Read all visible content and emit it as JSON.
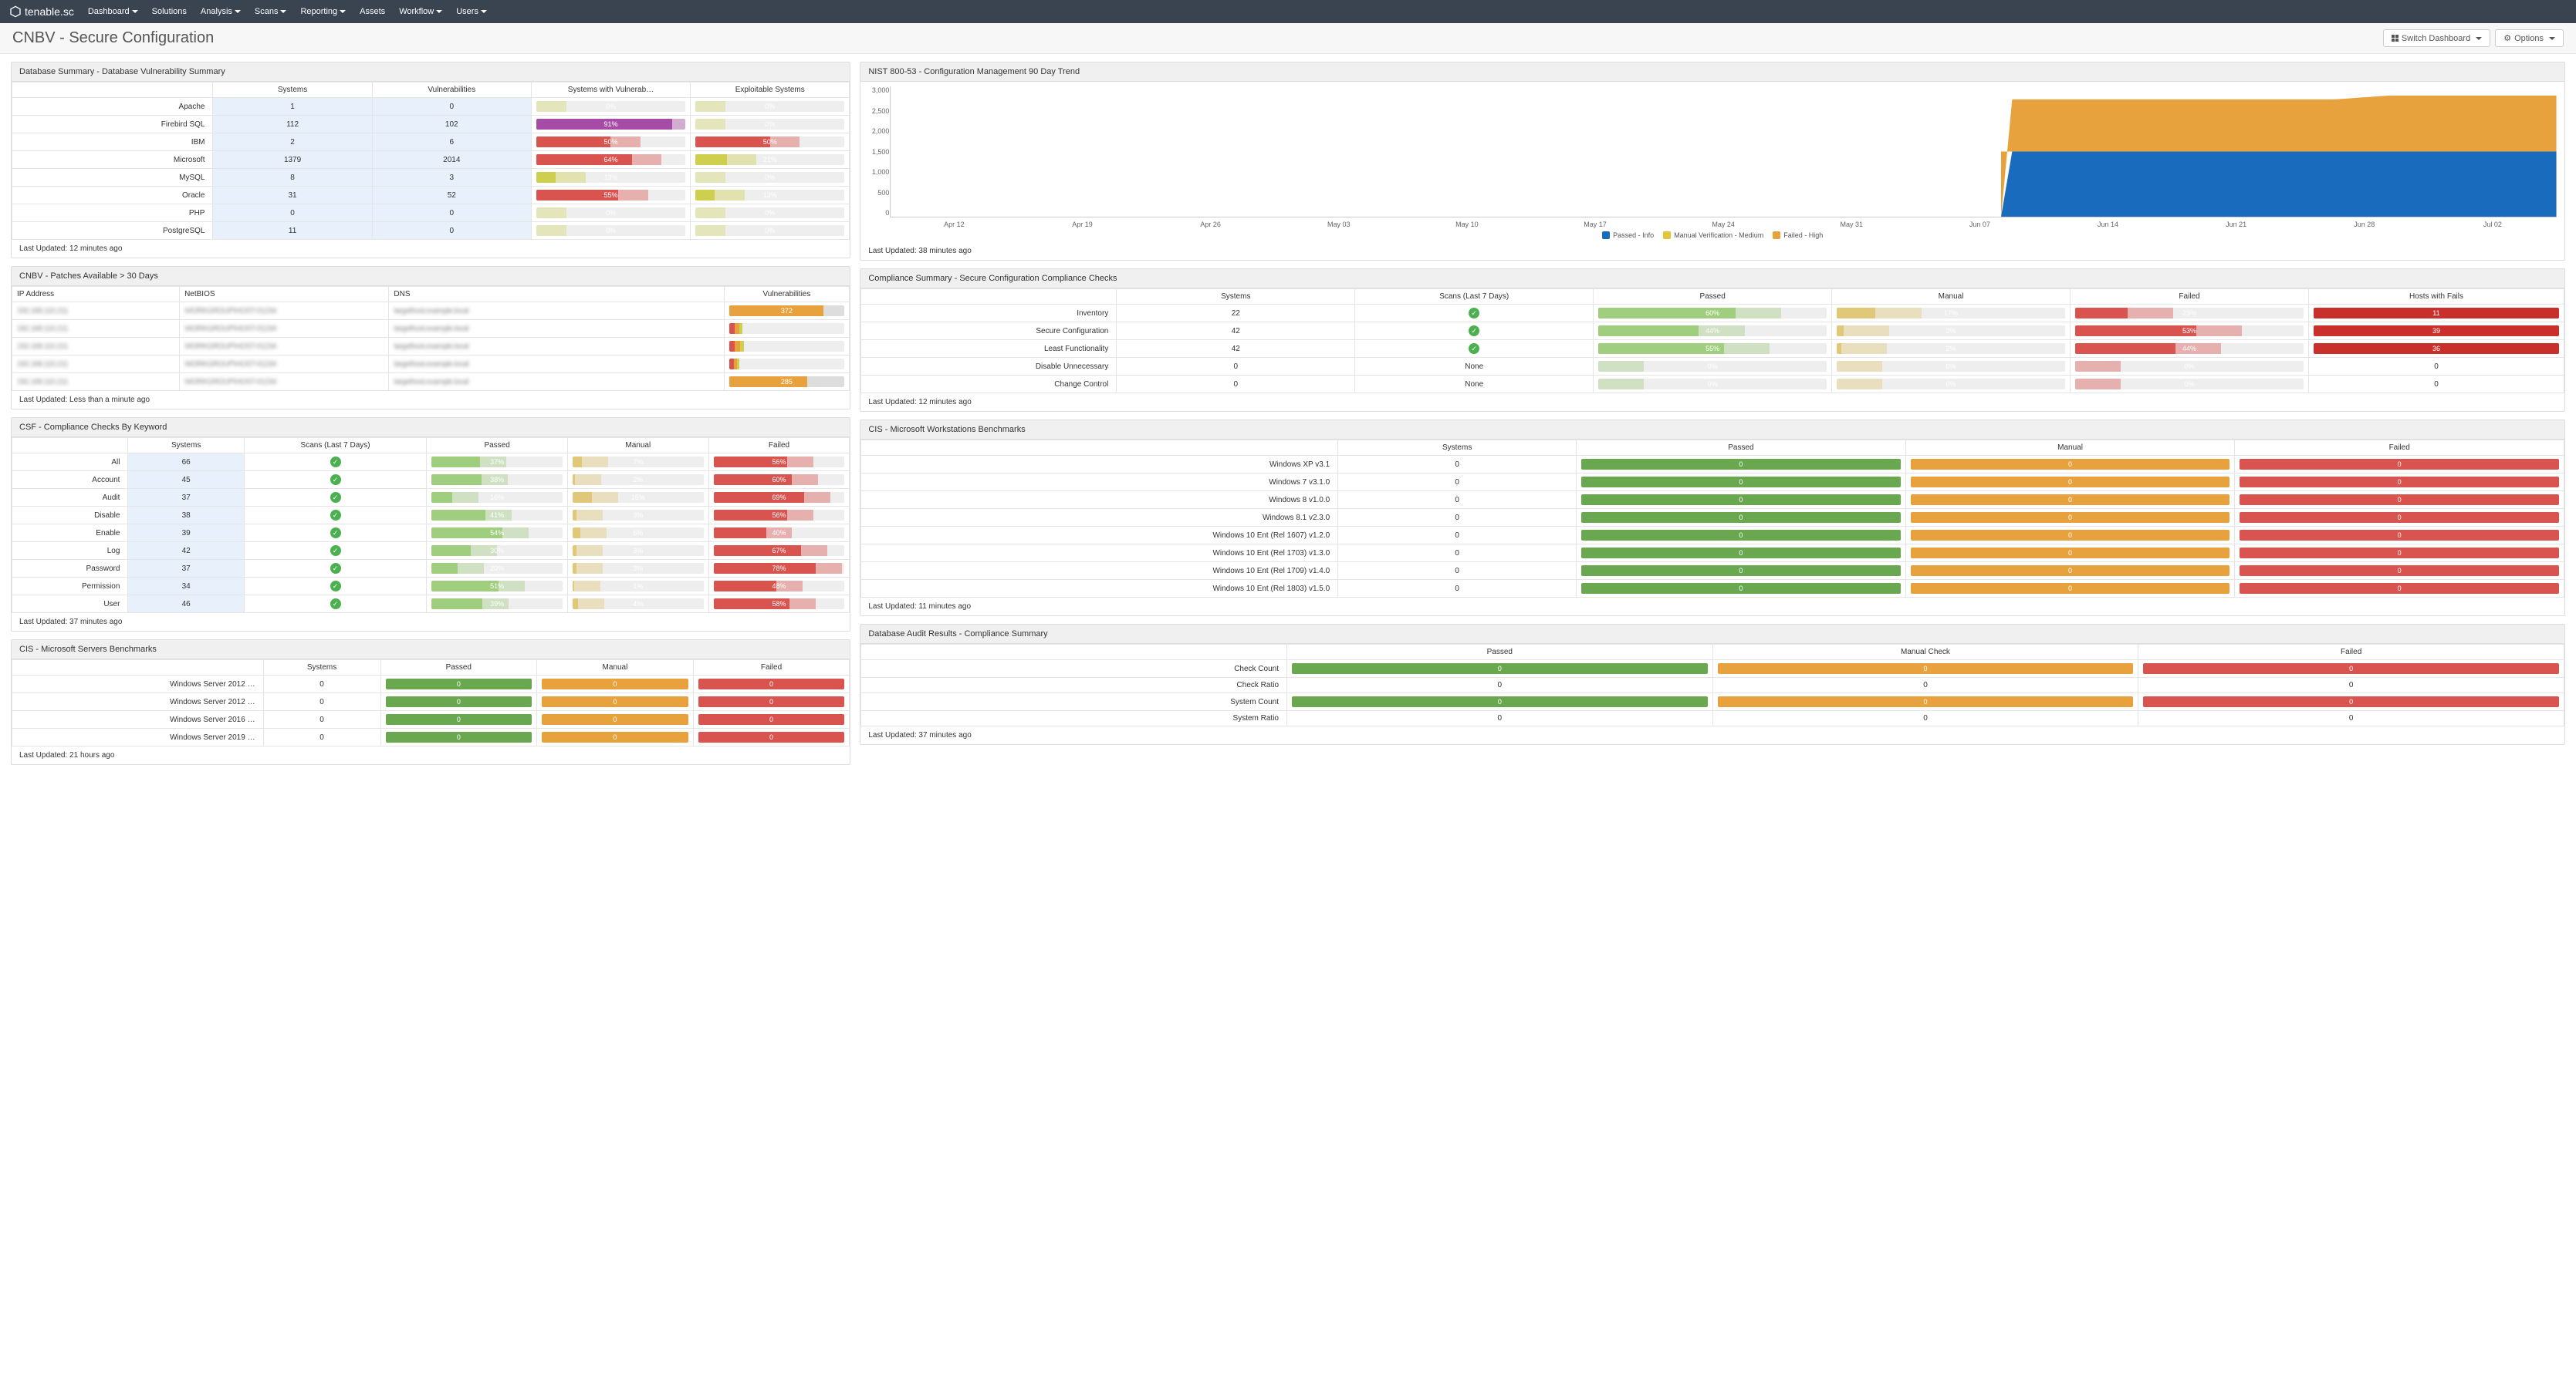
{
  "brand": "tenable.sc",
  "nav": [
    "Dashboard",
    "Solutions",
    "Analysis",
    "Scans",
    "Reporting",
    "Assets",
    "Workflow",
    "Users"
  ],
  "nav_has_caret": [
    true,
    false,
    true,
    true,
    true,
    false,
    true,
    true
  ],
  "page_title": "CNBV - Secure Configuration",
  "buttons": {
    "switch": "Switch Dashboard",
    "options": "Options"
  },
  "colors": {
    "green": "#6aa84f",
    "lightgreen": "#9fce7f",
    "yellow": "#d8d86f",
    "dyellow": "#cfcf4f",
    "orange": "#e8a23d",
    "red": "#d9534f",
    "darkred": "#c9302c",
    "pink": "#de7e7b",
    "purple": "#a64ca6",
    "blue": "#196bbd",
    "grey": "#ddd"
  },
  "panels": {
    "db_summary": {
      "title": "Database Summary - Database Vulnerability Summary",
      "headers": [
        "",
        "Systems",
        "Vulnerabilities",
        "Systems with Vulnerab…",
        "Exploitable Systems"
      ],
      "rows": [
        {
          "label": "Apache",
          "systems": "1",
          "vulns": "0",
          "swv": {
            "pct": 0,
            "txt": "0%",
            "color": "#d8d86f"
          },
          "exp": {
            "pct": 0,
            "txt": "0%",
            "color": "#d8d86f"
          }
        },
        {
          "label": "Firebird SQL",
          "systems": "112",
          "vulns": "102",
          "swv": {
            "pct": 91,
            "txt": "91%",
            "color": "#a64ca6"
          },
          "exp": {
            "pct": 0,
            "txt": "0%",
            "color": "#d8d86f"
          }
        },
        {
          "label": "IBM",
          "systems": "2",
          "vulns": "6",
          "swv": {
            "pct": 50,
            "txt": "50%",
            "color": "#d9534f"
          },
          "exp": {
            "pct": 50,
            "txt": "50%",
            "color": "#d9534f"
          }
        },
        {
          "label": "Microsoft",
          "systems": "1379",
          "vulns": "2014",
          "swv": {
            "pct": 64,
            "txt": "64%",
            "color": "#d9534f"
          },
          "exp": {
            "pct": 21,
            "txt": "21%",
            "color": "#cfcf4f"
          }
        },
        {
          "label": "MySQL",
          "systems": "8",
          "vulns": "3",
          "swv": {
            "pct": 13,
            "txt": "13%",
            "color": "#cfcf4f"
          },
          "exp": {
            "pct": 0,
            "txt": "0%",
            "color": "#d8d86f"
          }
        },
        {
          "label": "Oracle",
          "systems": "31",
          "vulns": "52",
          "swv": {
            "pct": 55,
            "txt": "55%",
            "color": "#d9534f"
          },
          "exp": {
            "pct": 13,
            "txt": "13%",
            "color": "#cfcf4f"
          }
        },
        {
          "label": "PHP",
          "systems": "0",
          "vulns": "0",
          "swv": {
            "pct": 0,
            "txt": "0%",
            "color": "#d8d86f"
          },
          "exp": {
            "pct": 0,
            "txt": "0%",
            "color": "#d8d86f"
          }
        },
        {
          "label": "PostgreSQL",
          "systems": "11",
          "vulns": "0",
          "swv": {
            "pct": 0,
            "txt": "0%",
            "color": "#d8d86f"
          },
          "exp": {
            "pct": 0,
            "txt": "0%",
            "color": "#d8d86f"
          }
        }
      ],
      "updated": "Last Updated: 12 minutes ago"
    },
    "patches": {
      "title": "CNBV - Patches Available > 30 Days",
      "headers": [
        "IP Address",
        "NetBIOS",
        "DNS",
        "Vulnerabilities"
      ],
      "rows": [
        {
          "vuln": "372",
          "segs": [
            {
              "w": 78,
              "c": "#e8a23d"
            },
            {
              "w": 4,
              "c": "#cfcf4f"
            }
          ]
        },
        {
          "vuln": "",
          "segs": [
            {
              "w": 5,
              "c": "#d9534f"
            },
            {
              "w": 4,
              "c": "#e8a23d"
            },
            {
              "w": 3,
              "c": "#cfcf4f"
            }
          ]
        },
        {
          "vuln": "",
          "segs": [
            {
              "w": 5,
              "c": "#d9534f"
            },
            {
              "w": 5,
              "c": "#e8a23d"
            },
            {
              "w": 3,
              "c": "#cfcf4f"
            }
          ]
        },
        {
          "vuln": "",
          "segs": [
            {
              "w": 4,
              "c": "#d9534f"
            },
            {
              "w": 3,
              "c": "#e8a23d"
            },
            {
              "w": 2,
              "c": "#cfcf4f"
            }
          ]
        },
        {
          "vuln": "285",
          "segs": [
            {
              "w": 60,
              "c": "#e8a23d"
            },
            {
              "w": 8,
              "c": "#cfcf4f"
            }
          ]
        }
      ],
      "updated": "Last Updated: Less than a minute ago"
    },
    "csf": {
      "title": "CSF - Compliance Checks By Keyword",
      "headers": [
        "",
        "Systems",
        "Scans (Last 7 Days)",
        "Passed",
        "Manual",
        "Failed"
      ],
      "rows": [
        {
          "label": "All",
          "systems": "66",
          "passed": {
            "pct": 37,
            "txt": "37%"
          },
          "manual": {
            "pct": 7,
            "txt": "7%"
          },
          "failed": {
            "pct": 56,
            "txt": "56%"
          }
        },
        {
          "label": "Account",
          "systems": "45",
          "passed": {
            "pct": 38,
            "txt": "38%"
          },
          "manual": {
            "pct": 2,
            "txt": "2%"
          },
          "failed": {
            "pct": 60,
            "txt": "60%"
          }
        },
        {
          "label": "Audit",
          "systems": "37",
          "passed": {
            "pct": 16,
            "txt": "16%"
          },
          "manual": {
            "pct": 15,
            "txt": "15%"
          },
          "failed": {
            "pct": 69,
            "txt": "69%"
          }
        },
        {
          "label": "Disable",
          "systems": "38",
          "passed": {
            "pct": 41,
            "txt": "41%"
          },
          "manual": {
            "pct": 3,
            "txt": "3%"
          },
          "failed": {
            "pct": 56,
            "txt": "56%"
          }
        },
        {
          "label": "Enable",
          "systems": "39",
          "passed": {
            "pct": 54,
            "txt": "54%"
          },
          "manual": {
            "pct": 6,
            "txt": "6%"
          },
          "failed": {
            "pct": 40,
            "txt": "40%"
          }
        },
        {
          "label": "Log",
          "systems": "42",
          "passed": {
            "pct": 30,
            "txt": "30%"
          },
          "manual": {
            "pct": 3,
            "txt": "3%"
          },
          "failed": {
            "pct": 67,
            "txt": "67%"
          }
        },
        {
          "label": "Password",
          "systems": "37",
          "passed": {
            "pct": 20,
            "txt": "20%"
          },
          "manual": {
            "pct": 3,
            "txt": "3%"
          },
          "failed": {
            "pct": 78,
            "txt": "78%"
          }
        },
        {
          "label": "Permission",
          "systems": "34",
          "passed": {
            "pct": 51,
            "txt": "51%"
          },
          "manual": {
            "pct": 1,
            "txt": "1%"
          },
          "failed": {
            "pct": 48,
            "txt": "48%"
          }
        },
        {
          "label": "User",
          "systems": "46",
          "passed": {
            "pct": 39,
            "txt": "39%"
          },
          "manual": {
            "pct": 4,
            "txt": "4%"
          },
          "failed": {
            "pct": 58,
            "txt": "58%"
          }
        }
      ],
      "updated": "Last Updated: 37 minutes ago"
    },
    "cis_servers": {
      "title": "CIS - Microsoft Servers Benchmarks",
      "headers": [
        "",
        "Systems",
        "Passed",
        "Manual",
        "Failed"
      ],
      "rows": [
        {
          "label": "Windows Server 2012 …",
          "systems": "0"
        },
        {
          "label": "Windows Server 2012 …",
          "systems": "0"
        },
        {
          "label": "Windows Server 2016 …",
          "systems": "0"
        },
        {
          "label": "Windows Server 2019 …",
          "systems": "0"
        }
      ],
      "updated": "Last Updated: 21 hours ago"
    },
    "nist": {
      "title": "NIST 800-53 - Configuration Management 90 Day Trend",
      "updated": "Last Updated: 38 minutes ago",
      "legend": [
        "Passed - Info",
        "Manual Verification - Medium",
        "Failed - High"
      ],
      "legend_colors": [
        "#196bbd",
        "#e8a23d",
        "#e8a23d"
      ]
    },
    "compliance": {
      "title": "Compliance Summary - Secure Configuration Compliance Checks",
      "headers": [
        "",
        "Systems",
        "Scans (Last 7 Days)",
        "Passed",
        "Manual",
        "Failed",
        "Hosts with Fails"
      ],
      "rows": [
        {
          "label": "Inventory",
          "systems": "22",
          "scans": "check",
          "passed": {
            "pct": 60,
            "txt": "60%"
          },
          "manual": {
            "pct": 17,
            "txt": "17%"
          },
          "failed": {
            "pct": 23,
            "txt": "23%"
          },
          "hosts": {
            "txt": "11"
          }
        },
        {
          "label": "Secure Configuration",
          "systems": "42",
          "scans": "check",
          "passed": {
            "pct": 44,
            "txt": "44%"
          },
          "manual": {
            "pct": 3,
            "txt": "3%"
          },
          "failed": {
            "pct": 53,
            "txt": "53%"
          },
          "hosts": {
            "txt": "39"
          }
        },
        {
          "label": "Least Functionality",
          "systems": "42",
          "scans": "check",
          "passed": {
            "pct": 55,
            "txt": "55%"
          },
          "manual": {
            "pct": 2,
            "txt": "2%"
          },
          "failed": {
            "pct": 44,
            "txt": "44%"
          },
          "hosts": {
            "txt": "36"
          }
        },
        {
          "label": "Disable Unnecessary",
          "systems": "0",
          "scans": "None",
          "passed": {
            "pct": 0,
            "txt": "0%"
          },
          "manual": {
            "pct": 0,
            "txt": "0%"
          },
          "failed": {
            "pct": 0,
            "txt": "0%"
          },
          "hosts": {
            "txt": "0",
            "plain": true
          }
        },
        {
          "label": "Change Control",
          "systems": "0",
          "scans": "None",
          "passed": {
            "pct": 0,
            "txt": "0%"
          },
          "manual": {
            "pct": 0,
            "txt": "0%"
          },
          "failed": {
            "pct": 0,
            "txt": "0%"
          },
          "hosts": {
            "txt": "0",
            "plain": true
          }
        }
      ],
      "updated": "Last Updated: 12 minutes ago"
    },
    "cis_ws": {
      "title": "CIS - Microsoft Workstations Benchmarks",
      "headers": [
        "",
        "Systems",
        "Passed",
        "Manual",
        "Failed"
      ],
      "rows": [
        {
          "label": "Windows XP v3.1",
          "systems": "0"
        },
        {
          "label": "Windows 7 v3.1.0",
          "systems": "0"
        },
        {
          "label": "Windows 8 v1.0.0",
          "systems": "0"
        },
        {
          "label": "Windows 8.1 v2.3.0",
          "systems": "0"
        },
        {
          "label": "Windows 10 Ent (Rel 1607) v1.2.0",
          "systems": "0"
        },
        {
          "label": "Windows 10 Ent (Rel 1703) v1.3.0",
          "systems": "0"
        },
        {
          "label": "Windows 10 Ent (Rel 1709) v1.4.0",
          "systems": "0"
        },
        {
          "label": "Windows 10 Ent (Rel 1803) v1.5.0",
          "systems": "0"
        }
      ],
      "updated": "Last Updated: 11 minutes ago"
    },
    "audit": {
      "title": "Database Audit Results - Compliance Summary",
      "headers": [
        "",
        "Passed",
        "Manual Check",
        "Failed"
      ],
      "rows": [
        {
          "label": "Check Count",
          "type": "pill"
        },
        {
          "label": "Check Ratio",
          "type": "plain"
        },
        {
          "label": "System Count",
          "type": "pill"
        },
        {
          "label": "System Ratio",
          "type": "plain"
        }
      ],
      "updated": "Last Updated: 37 minutes ago"
    }
  },
  "chart_data": {
    "type": "area",
    "ylim": [
      0,
      3000
    ],
    "yticks": [
      "3,000",
      "2,500",
      "2,000",
      "1,500",
      "1,000",
      "500",
      "0"
    ],
    "xticks": [
      "Apr 12",
      "Apr 19",
      "Apr 26",
      "May 03",
      "May 10",
      "May 17",
      "May 24",
      "May 31",
      "Jun 07",
      "Jun 14",
      "Jun 21",
      "Jun 28",
      "Jul 02"
    ],
    "series": [
      {
        "name": "Passed - Info",
        "color": "#196bbd",
        "start_idx": 8,
        "y": 1500
      },
      {
        "name": "Manual Verification - Medium",
        "color": "#e8a23d",
        "start_idx": 8,
        "y": 0
      },
      {
        "name": "Failed - High",
        "color": "#e8a23d",
        "start_idx": 8,
        "y": 2700
      }
    ],
    "note": "Values are ~0 before Jun 07; from Jun 07 onward Passed≈1500 (blue band 0–1500), Failed≈2700 stacked on top (orange band 1500–2700), slight rise near Jun 21."
  }
}
